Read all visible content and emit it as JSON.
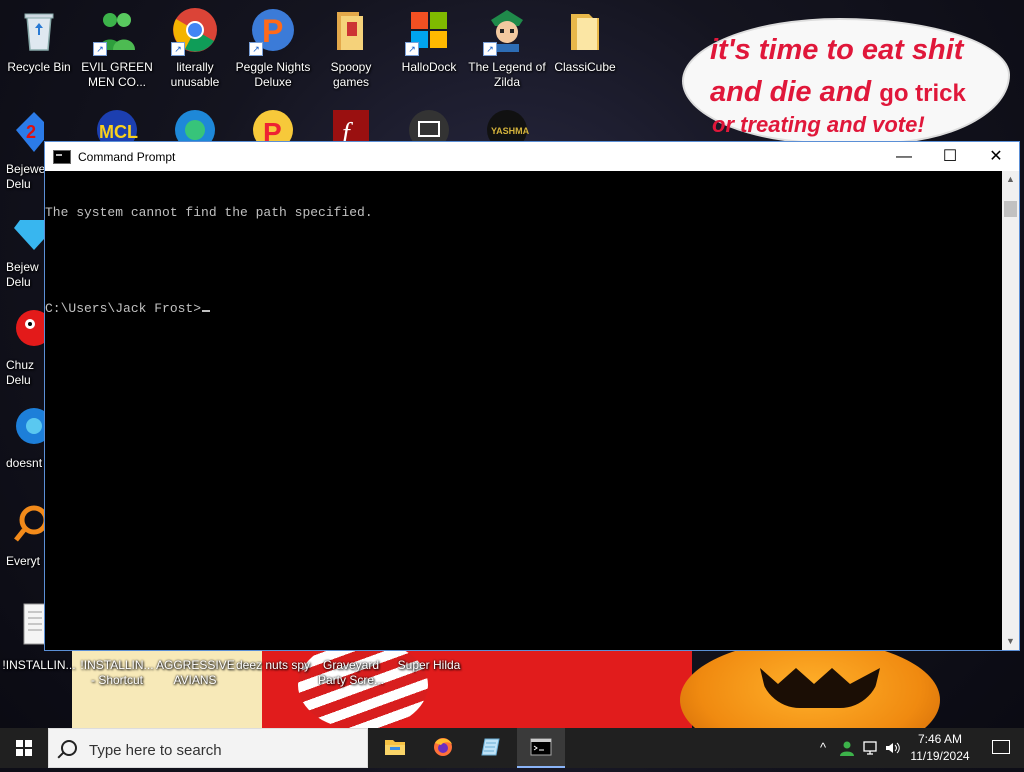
{
  "desktop": {
    "icons_top": [
      {
        "label": "Recycle Bin",
        "icon": "recycle-bin-icon"
      },
      {
        "label": "EVIL GREEN MEN CO...",
        "icon": "green-men-icon"
      },
      {
        "label": "literally unusable",
        "icon": "chrome-icon"
      },
      {
        "label": "Peggle Nights Deluxe",
        "icon": "peggle-icon"
      },
      {
        "label": "Spoopy games",
        "icon": "folder-icon"
      },
      {
        "label": "HalloDock",
        "icon": "windows-logo-icon"
      },
      {
        "label": "The Legend of Zilda",
        "icon": "zilda-icon"
      },
      {
        "label": "ClassiCube",
        "icon": "folder-icon"
      }
    ],
    "icons_left": [
      {
        "label": "Bejewe Delu",
        "icon": "bejeweled-icon"
      },
      {
        "label": "Bejew Delu",
        "icon": "diamond-icon"
      },
      {
        "label": "Chuz Delu",
        "icon": "chuzzle-icon"
      },
      {
        "label": "doesnt",
        "icon": "edge-icon"
      },
      {
        "label": "Everyt",
        "icon": "everything-search-icon"
      },
      {
        "label": "!INSTALLIN...",
        "icon": "document-icon"
      }
    ],
    "icons_bottom": [
      {
        "label": "!INSTALLIN... - Shortcut"
      },
      {
        "label": "AGGRESSIVE AVIANS"
      },
      {
        "label": "deez nuts spy"
      },
      {
        "label": "Graveyard Party Scre..."
      },
      {
        "label": "Super Hilda"
      }
    ],
    "speech_bubble": {
      "line1": "it's time to eat shit",
      "line2": "and die and ",
      "line2b": "go trick",
      "line3": "or treating and vote!"
    }
  },
  "window": {
    "title": "Command Prompt",
    "minimize": "—",
    "maximize": "☐",
    "close": "✕",
    "console_lines": [
      "The system cannot find the path specified.",
      "",
      "C:\\Users\\Jack Frost>"
    ]
  },
  "taskbar": {
    "search_placeholder": "Type here to search",
    "apps": [
      {
        "name": "file-explorer-icon"
      },
      {
        "name": "firefox-icon"
      },
      {
        "name": "notepad-icon"
      },
      {
        "name": "command-prompt-icon",
        "active": true
      }
    ],
    "tray": {
      "chevron": "^",
      "clock_time": "7:46 AM",
      "clock_date": "11/19/2024"
    }
  },
  "colors": {
    "taskbar": "#202020",
    "console_bg": "#000000",
    "console_text": "#c0c0c0",
    "bubble_text": "#e0173a"
  }
}
